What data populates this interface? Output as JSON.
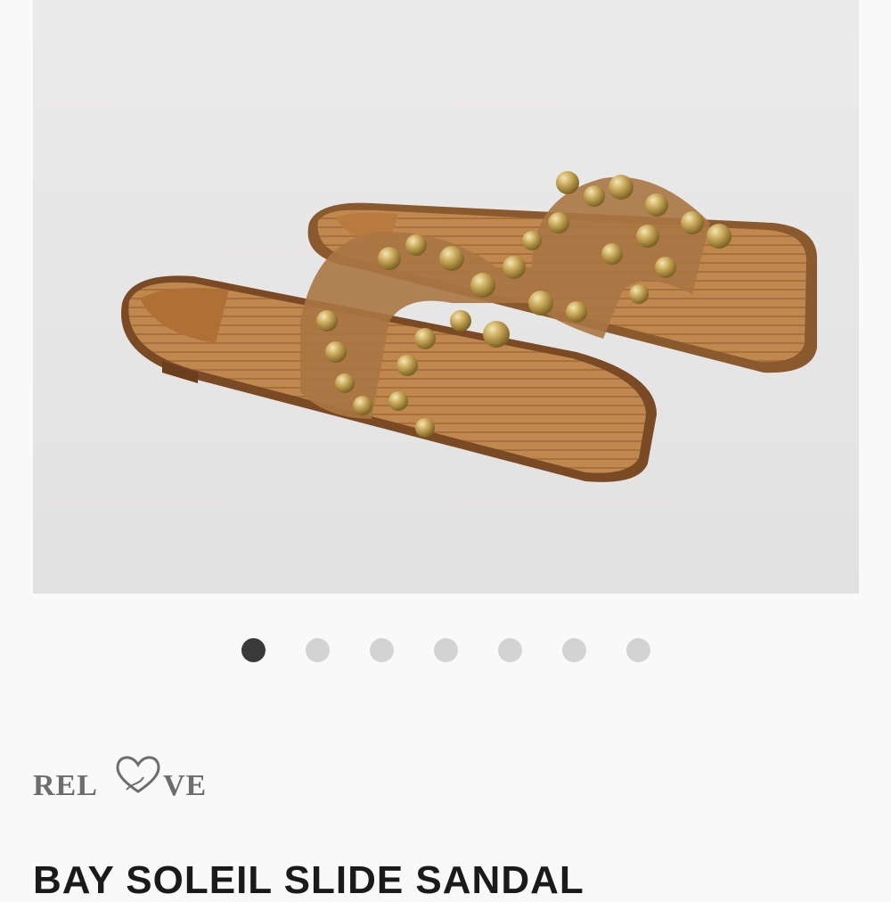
{
  "product": {
    "image_alt": "Bay Soleil Slide Sandal product photo",
    "title": "BAY SOLEIL SLIDE SANDAL"
  },
  "gallery": {
    "total": 7,
    "active_index": 0
  },
  "brand": {
    "logo_text": "RELOVE"
  },
  "colors": {
    "active_dot": "#3a3a3a",
    "inactive_dot": "#d3d3d3",
    "logo": "#6d6d6d",
    "title": "#1a1a1a"
  }
}
